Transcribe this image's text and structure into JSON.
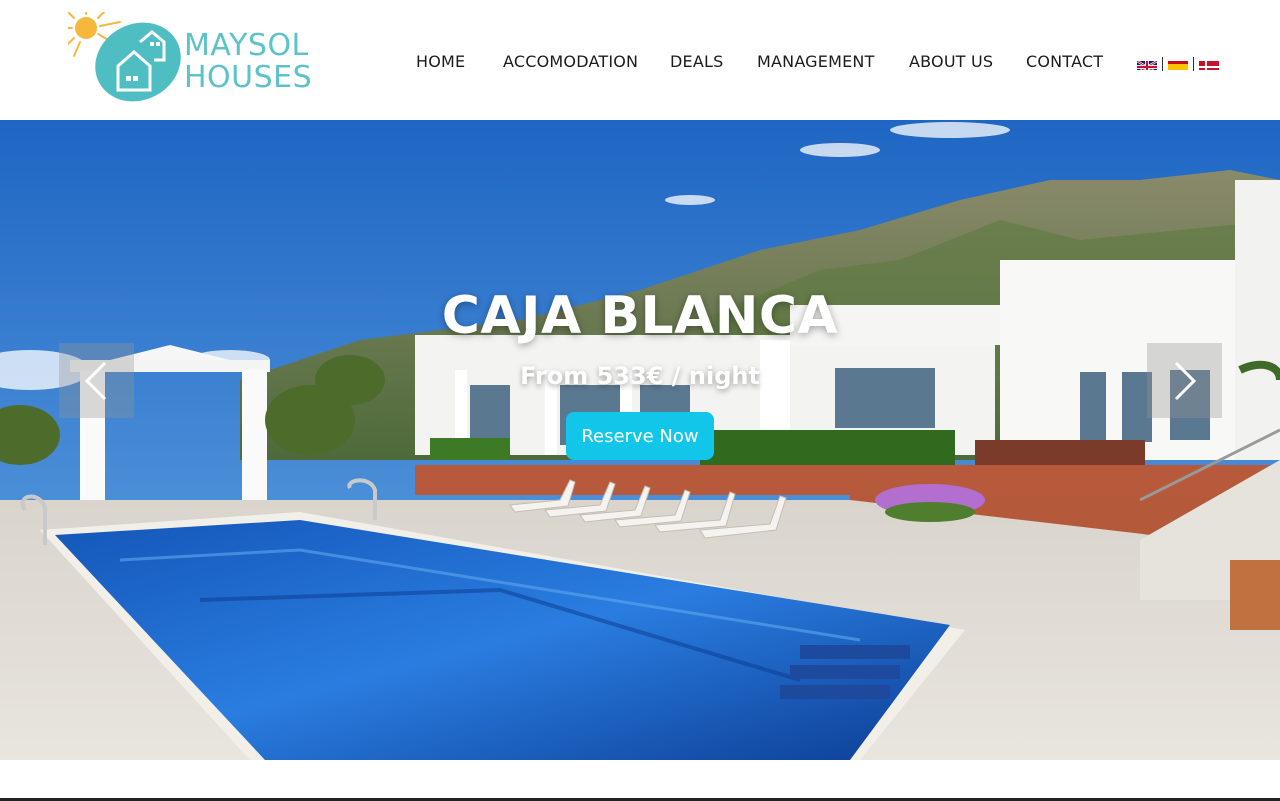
{
  "brand": {
    "line1": "MAYSOL",
    "line2": "HOUSES",
    "color": "#5cc3c8"
  },
  "nav": {
    "home": "HOME",
    "accomodation": "ACCOMODATION",
    "deals": "DEALS",
    "management": "MANAGEMENT",
    "about": "ABOUT US",
    "contact": "CONTACT"
  },
  "languages": [
    "English",
    "Spanish",
    "Danish"
  ],
  "hero": {
    "title": "CAJA BLANCA",
    "subtitle": "From 533€ / night",
    "cta": "Reserve Now",
    "cta_color": "#12c6ea"
  },
  "icons": [
    "sun-house-logo-icon",
    "chevron-left-icon",
    "chevron-right-icon",
    "flag-uk-icon",
    "flag-spain-icon",
    "flag-denmark-icon"
  ]
}
